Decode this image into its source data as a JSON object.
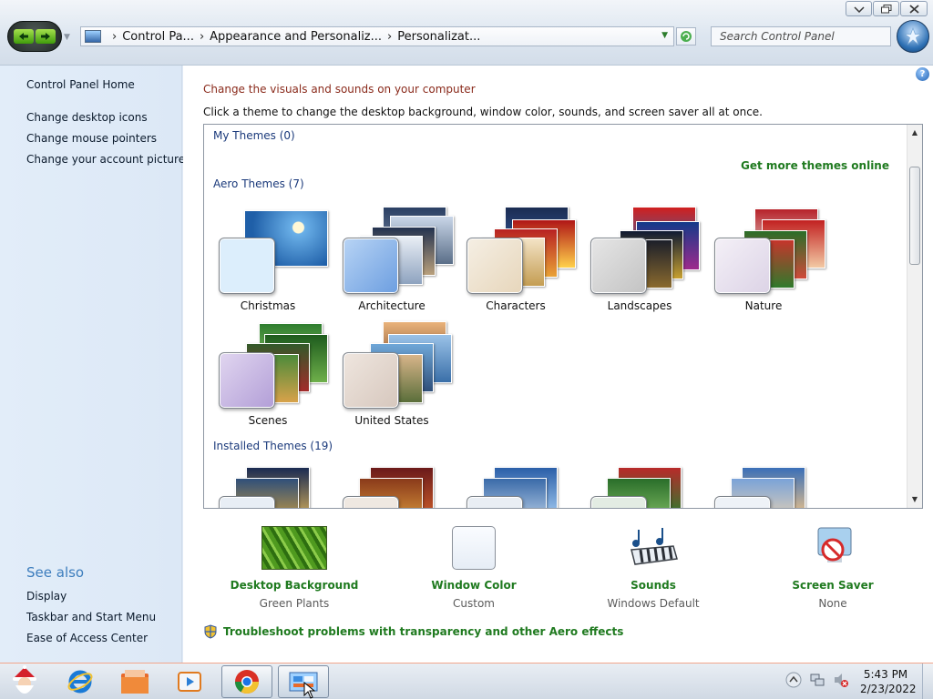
{
  "window": {
    "nav": {
      "back_icon": "back-arrow-icon",
      "forward_icon": "forward-arrow-icon"
    },
    "breadcrumbs": [
      "Control Pa...",
      "Appearance and Personaliz...",
      "Personalizat..."
    ],
    "search_placeholder": "Search Control Panel",
    "controls": [
      "minimize",
      "maximize",
      "close"
    ]
  },
  "sidebar": {
    "home": "Control Panel Home",
    "links": [
      "Change desktop icons",
      "Change mouse pointers",
      "Change your account picture"
    ],
    "see_also_label": "See also",
    "see_also": [
      "Display",
      "Taskbar and Start Menu",
      "Ease of Access Center"
    ]
  },
  "main": {
    "heading": "Change the visuals and sounds on your computer",
    "instruction": "Click a theme to change the desktop background, window color, sounds, and screen saver all at once.",
    "my_themes": "My Themes (0)",
    "get_more": "Get more themes online",
    "aero_themes": "Aero Themes (7)",
    "installed_themes": "Installed Themes (19)",
    "themes": [
      {
        "name": "Christmas",
        "swatch": "#dceefc"
      },
      {
        "name": "Architecture",
        "swatch": "#9cc3ef"
      },
      {
        "name": "Characters",
        "swatch": "#efe5d6"
      },
      {
        "name": "Landscapes",
        "swatch": "#d7d7d7"
      },
      {
        "name": "Nature",
        "swatch": "#ece6f1"
      },
      {
        "name": "Scenes",
        "swatch": "#cdbde6"
      },
      {
        "name": "United States",
        "swatch": "#e4d9d2"
      }
    ],
    "settings": [
      {
        "label": "Desktop Background",
        "value": "Green Plants",
        "icon": "desktop-background-icon"
      },
      {
        "label": "Window Color",
        "value": "Custom",
        "icon": "window-color-icon"
      },
      {
        "label": "Sounds",
        "value": "Windows Default",
        "icon": "sounds-icon"
      },
      {
        "label": "Screen Saver",
        "value": "None",
        "icon": "screen-saver-icon"
      }
    ],
    "troubleshoot": "Troubleshoot problems with transparency and other Aero effects"
  },
  "taskbar": {
    "time": "5:43 PM",
    "date": "2/23/2022",
    "apps": [
      "start-santa-icon",
      "internet-explorer-icon",
      "file-explorer-icon",
      "media-player-icon",
      "chrome-icon",
      "control-panel-icon"
    ]
  },
  "colors": {
    "link_green": "#1f7a1f",
    "heading_red": "#8a2a1b",
    "group_blue": "#1b3a7b"
  }
}
